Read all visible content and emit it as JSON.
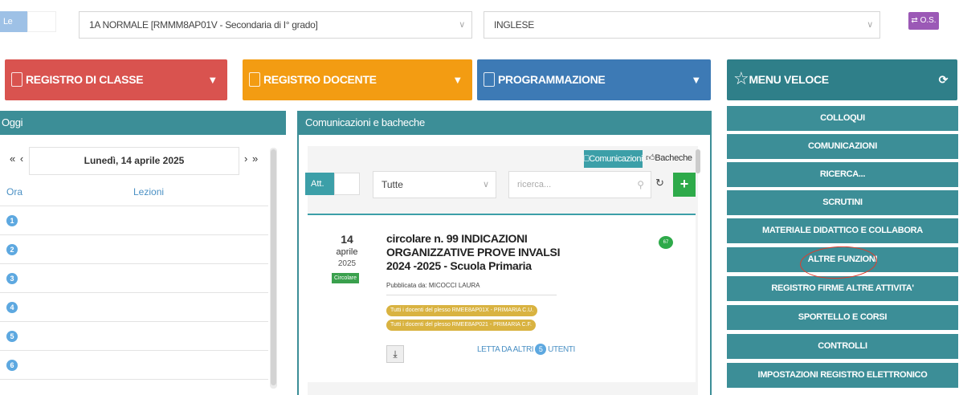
{
  "top": {
    "lemie_label": "Le mie",
    "class_select": "1A NORMALE [RMMM8AP01V - Secondaria di I° grado]",
    "subject_select": "INGLESE",
    "os_button": "⇄ O.S."
  },
  "headers": {
    "registro_classe": "REGISTRO DI CLASSE",
    "registro_docente": "REGISTRO DOCENTE",
    "programmazione": "PROGRAMMAZIONE",
    "menu_veloce": "MENU VELOCE"
  },
  "oggi": {
    "title": "Oggi",
    "nav_prev": "« ‹",
    "date": "Lunedì, 14 aprile 2025",
    "nav_next": "› »",
    "col_ora": "Ora",
    "col_lezioni": "Lezioni",
    "hours": [
      "1",
      "2",
      "3",
      "4",
      "5",
      "6"
    ]
  },
  "comunicazioni": {
    "title": "Comunicazioni e bacheche",
    "tab_comunicazioni": "Comunicazioni",
    "tab_bacheche": "Bacheche",
    "att_label": "Att.",
    "filter_value": "Tutte",
    "search_placeholder": "ricerca...",
    "item": {
      "day": "14",
      "month": "aprile",
      "year": "2025",
      "type_badge": "Circolare",
      "title": "circolare n. 99 INDICAZIONI ORGANIZZATIVE PROVE INVALSI 2024 -2025 - Scuola Primaria",
      "published_by": "Pubblicata da: MICOCCI LAURA",
      "tags": [
        "Tutti i docenti del plesso RMEE8AP01X - PRIMARIA C.U.",
        "Tutti i docenti del plesso RMEE8AP021 - PRIMARIA C.F."
      ],
      "count_badge": "67",
      "read_prefix": "LETTA DA ALTRI",
      "read_count": "5",
      "read_suffix": "UTENTI"
    }
  },
  "menu_veloce": {
    "items": [
      "COLLOQUI",
      "COMUNICAZIONI",
      "RICERCA...",
      "SCRUTINI",
      "MATERIALE DIDATTICO E COLLABORA",
      "ALTRE FUNZIONI",
      "REGISTRO FIRME ALTRE ATTIVITA'",
      "SPORTELLO E CORSI",
      "CONTROLLI",
      "IMPOSTAZIONI REGISTRO ELETTRONICO"
    ]
  },
  "colors": {
    "red": "#d9534f",
    "orange": "#f39c12",
    "blue": "#3d7ab5",
    "teal": "#3c8e97",
    "annotation": "#e23b2a"
  }
}
